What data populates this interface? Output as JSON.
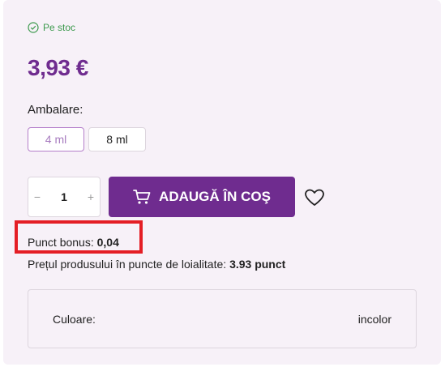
{
  "stock": {
    "text": "Pe stoc",
    "icon": "check-circle-icon",
    "color": "#3d9a4e"
  },
  "price": "3,93 €",
  "packaging": {
    "label": "Ambalare:",
    "options": [
      "4 ml",
      "8 ml"
    ],
    "selected": "4 ml"
  },
  "quantity": {
    "value": "1",
    "minus": "−",
    "plus": "+"
  },
  "cart": {
    "label": "ADAUGĂ ÎN COŞ",
    "icon": "cart-icon"
  },
  "wishlist": {
    "icon": "heart-icon"
  },
  "bonus": {
    "label": "Punct bonus:",
    "value": "0,04"
  },
  "loyalty": {
    "label": "Prețul produsului în puncte de loialitate:",
    "value": "3.93 punct"
  },
  "attribute": {
    "label": "Culoare:",
    "value": "incolor"
  },
  "colors": {
    "accent": "#6f2c8f",
    "highlight": "#e41e25",
    "background": "#f7f1f8"
  }
}
